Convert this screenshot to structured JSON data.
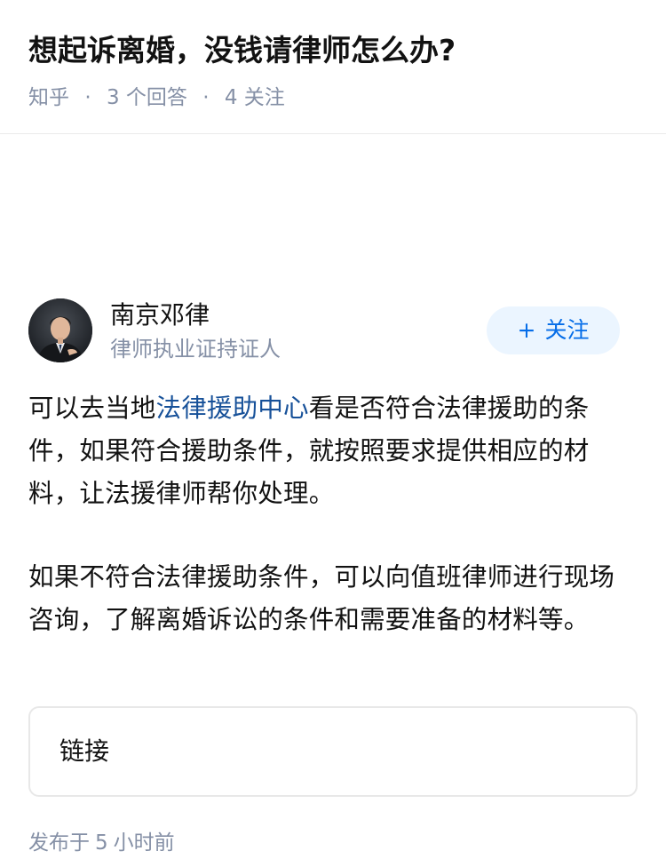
{
  "question": {
    "title": "想起诉离婚，没钱请律师怎么办?",
    "source": "知乎",
    "separator": "·",
    "answers_count": "3",
    "answers_label": "个回答",
    "followers_count": "4",
    "followers_label": "关注"
  },
  "answer": {
    "author": {
      "name": "南京邓律",
      "headline": "律师执业证持证人",
      "follow_icon": "plus-icon",
      "follow_plus": "+",
      "follow_label": "关注"
    },
    "content": {
      "p1_before": "可以去当地",
      "p1_link": "法律援助中心",
      "p1_after": "看是否符合法律援助的条件，如果符合援助条件，就按照要求提供相应的材料，让法援律师帮你处理。",
      "p2": "如果不符合法律援助条件，可以向值班律师进行现场咨询，了解离婚诉讼的条件和需要准备的材料等。"
    },
    "link_card": {
      "title": "链接"
    },
    "published": {
      "prefix": "发布于",
      "amount": "5",
      "unit": "小时前"
    }
  },
  "colors": {
    "title": "#121212",
    "meta": "#8590a6",
    "link": "#175199",
    "follow_text": "#056de8",
    "follow_bg": "#ebf5ff",
    "divider": "#ebebeb"
  }
}
